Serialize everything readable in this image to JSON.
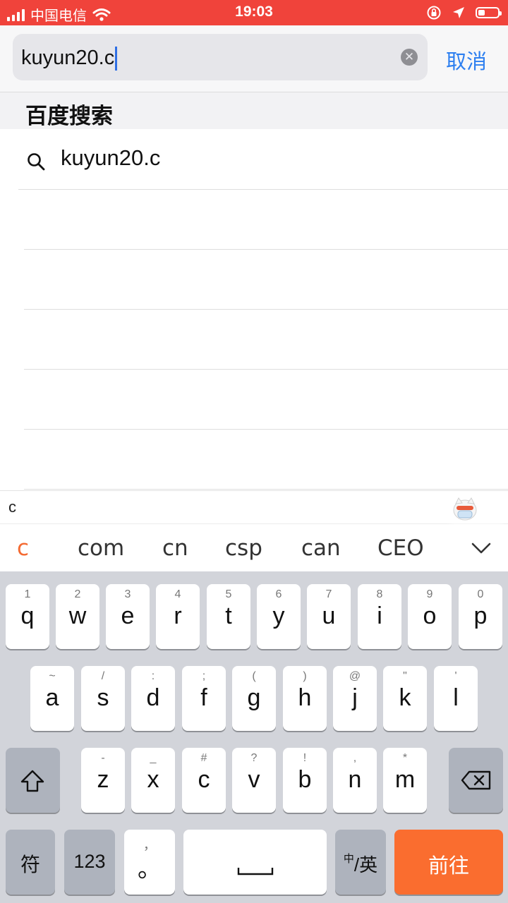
{
  "status_bar": {
    "carrier": "中国电信",
    "time": "19:03"
  },
  "search": {
    "query": "kuyun20.c",
    "cancel_label": "取消"
  },
  "section": {
    "title": "百度搜索"
  },
  "results": [
    {
      "label": "kuyun20.c"
    }
  ],
  "ime": {
    "composition": "c",
    "candidates": [
      "c",
      "com",
      "cn",
      "csp",
      "can",
      "CEO"
    ]
  },
  "keyboard": {
    "row1": [
      {
        "key": "q",
        "hint": "1"
      },
      {
        "key": "w",
        "hint": "2"
      },
      {
        "key": "e",
        "hint": "3"
      },
      {
        "key": "r",
        "hint": "4"
      },
      {
        "key": "t",
        "hint": "5"
      },
      {
        "key": "y",
        "hint": "6"
      },
      {
        "key": "u",
        "hint": "7"
      },
      {
        "key": "i",
        "hint": "8"
      },
      {
        "key": "o",
        "hint": "9"
      },
      {
        "key": "p",
        "hint": "0"
      }
    ],
    "row2": [
      {
        "key": "a",
        "hint": "~"
      },
      {
        "key": "s",
        "hint": "/"
      },
      {
        "key": "d",
        "hint": ":"
      },
      {
        "key": "f",
        "hint": ";"
      },
      {
        "key": "g",
        "hint": "("
      },
      {
        "key": "h",
        "hint": ")"
      },
      {
        "key": "j",
        "hint": "@"
      },
      {
        "key": "k",
        "hint": "\""
      },
      {
        "key": "l",
        "hint": "'"
      }
    ],
    "row3": [
      {
        "key": "z",
        "hint": "-"
      },
      {
        "key": "x",
        "hint": "_"
      },
      {
        "key": "c",
        "hint": "#"
      },
      {
        "key": "v",
        "hint": "?"
      },
      {
        "key": "b",
        "hint": "!"
      },
      {
        "key": "n",
        "hint": ","
      },
      {
        "key": "m",
        "hint": "*"
      }
    ],
    "symbol_label": "符",
    "number_label": "123",
    "punct_hint": "，",
    "punct_label": "。",
    "lang_small": "中",
    "lang_label": "/英",
    "go_label": "前往"
  },
  "colors": {
    "status_bar": "#f0433b",
    "accent_blue": "#2d7ff0",
    "go_key": "#fa6d2f",
    "keyboard_bg": "#d2d4da"
  }
}
